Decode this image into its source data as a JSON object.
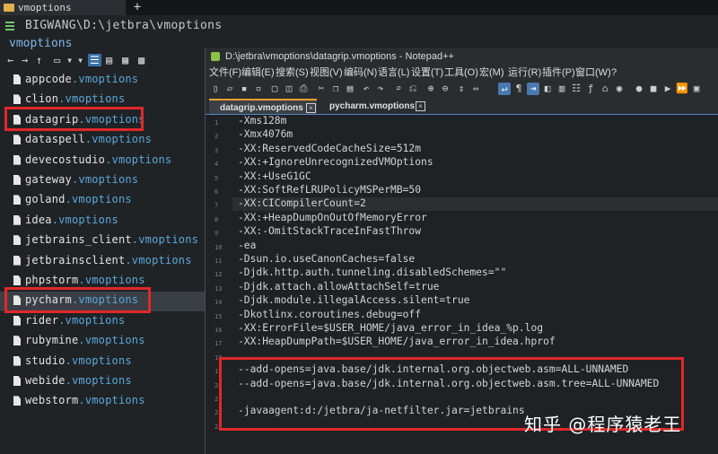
{
  "file_manager": {
    "tab_label": "vmoptions",
    "new_tab_symbol": "+",
    "path": "BIGWANG\\D:\\jetbra\\vmoptions",
    "folder_name": "vmoptions",
    "files": [
      {
        "base": "appcode",
        "ext": ".vmoptions"
      },
      {
        "base": "clion",
        "ext": ".vmoptions"
      },
      {
        "base": "datagrip",
        "ext": ".vmoptions"
      },
      {
        "base": "dataspell",
        "ext": ".vmoptions"
      },
      {
        "base": "devecostudio",
        "ext": ".vmoptions"
      },
      {
        "base": "gateway",
        "ext": ".vmoptions"
      },
      {
        "base": "goland",
        "ext": ".vmoptions"
      },
      {
        "base": "idea",
        "ext": ".vmoptions"
      },
      {
        "base": "jetbrains_client",
        "ext": ".vmoptions"
      },
      {
        "base": "jetbrainsclient",
        "ext": ".vmoptions"
      },
      {
        "base": "phpstorm",
        "ext": ".vmoptions"
      },
      {
        "base": "pycharm",
        "ext": ".vmoptions"
      },
      {
        "base": "rider",
        "ext": ".vmoptions"
      },
      {
        "base": "rubymine",
        "ext": ".vmoptions"
      },
      {
        "base": "studio",
        "ext": ".vmoptions"
      },
      {
        "base": "webide",
        "ext": ".vmoptions"
      },
      {
        "base": "webstorm",
        "ext": ".vmoptions"
      }
    ]
  },
  "notepad": {
    "title": "D:\\jetbra\\vmoptions\\datagrip.vmoptions - Notepad++",
    "menu": [
      "文件(F)",
      "编辑(E)",
      "搜索(S)",
      "视图(V)",
      "编码(N)",
      "语言(L)",
      "设置(T)",
      "工具(O)",
      "宏(M)",
      "运行(R)",
      "插件(P)",
      "窗口(W)",
      "?"
    ],
    "tabs": [
      "datagrip.vmoptions",
      "pycharm.vmoptions"
    ],
    "lines": [
      {
        "num": "1",
        "text": "-Xms128m"
      },
      {
        "num": "2",
        "text": "-Xmx4076m"
      },
      {
        "num": "3",
        "text": "-XX:ReservedCodeCacheSize=512m"
      },
      {
        "num": "4",
        "text": "-XX:+IgnoreUnrecognizedVMOptions"
      },
      {
        "num": "5",
        "text": "-XX:+UseG1GC"
      },
      {
        "num": "6",
        "text": "-XX:SoftRefLRUPolicyMSPerMB=50"
      },
      {
        "num": "7",
        "text": "-XX:CICompilerCount=2"
      },
      {
        "num": "8",
        "text": "-XX:+HeapDumpOnOutOfMemoryError"
      },
      {
        "num": "9",
        "text": "-XX:-OmitStackTraceInFastThrow"
      },
      {
        "num": "10",
        "text": "-ea"
      },
      {
        "num": "11",
        "text": "-Dsun.io.useCanonCaches=false"
      },
      {
        "num": "12",
        "text": "-Djdk.http.auth.tunneling.disabledSchemes=\"\""
      },
      {
        "num": "13",
        "text": "-Djdk.attach.allowAttachSelf=true"
      },
      {
        "num": "14",
        "text": "-Djdk.module.illegalAccess.silent=true"
      },
      {
        "num": "15",
        "text": "-Dkotlinx.coroutines.debug=off"
      },
      {
        "num": "16",
        "text": "-XX:ErrorFile=$USER_HOME/java_error_in_idea_%p.log"
      },
      {
        "num": "17",
        "text": "-XX:HeapDumpPath=$USER_HOME/java_error_in_idea.hprof"
      },
      {
        "num": "18",
        "text": ""
      },
      {
        "num": "19",
        "text": "--add-opens=java.base/jdk.internal.org.objectweb.asm=ALL-UNNAMED"
      },
      {
        "num": "20",
        "text": "--add-opens=java.base/jdk.internal.org.objectweb.asm.tree=ALL-UNNAMED"
      },
      {
        "num": "21",
        "text": ""
      },
      {
        "num": "22",
        "text": "-javaagent:d:/jetbra/ja-netfilter.jar=jetbrains"
      },
      {
        "num": "23",
        "text": ""
      }
    ]
  },
  "watermark": "知乎 @程序猿老王"
}
